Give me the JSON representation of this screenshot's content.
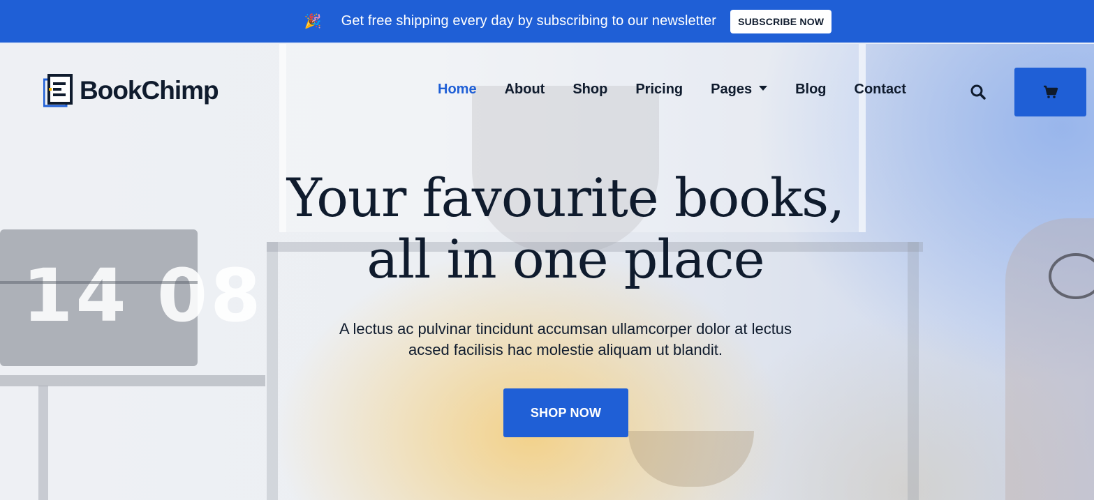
{
  "colors": {
    "primary": "#1f5fd6",
    "text_dark": "#0f1b2d",
    "white": "#ffffff"
  },
  "promo": {
    "icon": "party-popper-icon",
    "text": "Get free shipping every day by subscribing to our newsletter",
    "button_label": "SUBSCRIBE NOW"
  },
  "header": {
    "logo_text": "BookChimp",
    "logo_icon": "book-logo-icon",
    "nav": [
      {
        "label": "Home",
        "active": true
      },
      {
        "label": "About"
      },
      {
        "label": "Shop"
      },
      {
        "label": "Pricing"
      },
      {
        "label": "Pages",
        "has_dropdown": true
      },
      {
        "label": "Blog"
      },
      {
        "label": "Contact"
      }
    ],
    "search_icon": "search-icon",
    "cart_icon": "cart-icon"
  },
  "hero": {
    "headline_line1": "Your favourite books,",
    "headline_line2": "all in one place",
    "subtext_line1": "A lectus ac pulvinar tincidunt accumsan ullamcorper dolor at lectus",
    "subtext_line2": "acsed facilisis hac molestie aliquam ut blandit.",
    "cta_label": "SHOP NOW",
    "background_clock_text": "14 08"
  }
}
